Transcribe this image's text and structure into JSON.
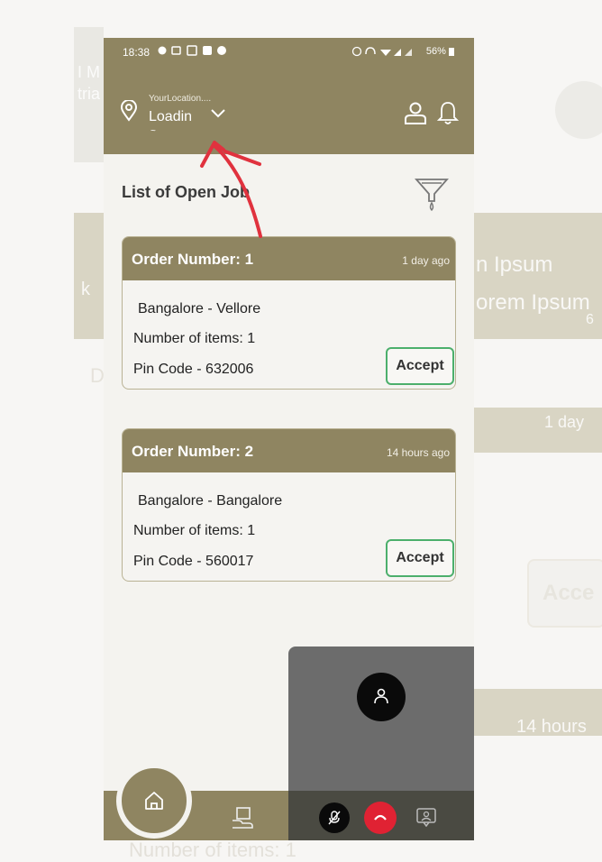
{
  "background": {
    "fragments": [
      "I M",
      "tria",
      "k",
      "n Ipsum",
      "orem Ipsum",
      "6",
      "D",
      "1 day",
      "Acce",
      "14 hours",
      "Number of items: 1"
    ]
  },
  "status_bar": {
    "time": "18:38",
    "left_icons": [
      "chat-bubble-icon",
      "video-icon",
      "gallery-icon",
      "media-icon",
      "whatsapp-icon"
    ],
    "right_icons": [
      "alarm-icon",
      "headphone-icon",
      "wifi-icon",
      "signal-icon"
    ],
    "battery": "56%"
  },
  "header": {
    "location_label": "YourLocation....",
    "location_value": "Loadin",
    "location_sub": "~",
    "icons": [
      "location-pin-icon",
      "chevron-down-icon",
      "user-icon",
      "bell-icon"
    ]
  },
  "main": {
    "title": "List of Open Job",
    "filter_icon": "filter-icon"
  },
  "orders": [
    {
      "title": "Order Number: 1",
      "time_ago": "1 day ago",
      "route": "Bangalore - Vellore",
      "items": "Number of items: 1",
      "pin": "Pin Code - 632006",
      "accept_label": "Accept"
    },
    {
      "title": "Order Number: 2",
      "time_ago": "14 hours ago",
      "route": "Bangalore - Bangalore",
      "items": "Number of items: 1",
      "pin": "Pin Code - 560017",
      "accept_label": "Accept"
    }
  ],
  "bottom_nav": {
    "icons": [
      "home-icon",
      "box-hand-icon"
    ]
  },
  "call_overlay": {
    "icons": [
      "person-icon",
      "mute-mic-icon",
      "end-call-icon",
      "chat-person-icon"
    ],
    "colors": {
      "end_call": "#e02233",
      "panel": "#6c6c6c"
    }
  },
  "colors": {
    "brand": "#8f8561",
    "accept_border": "#4caf6c",
    "annotation_arrow": "#e0323e"
  }
}
